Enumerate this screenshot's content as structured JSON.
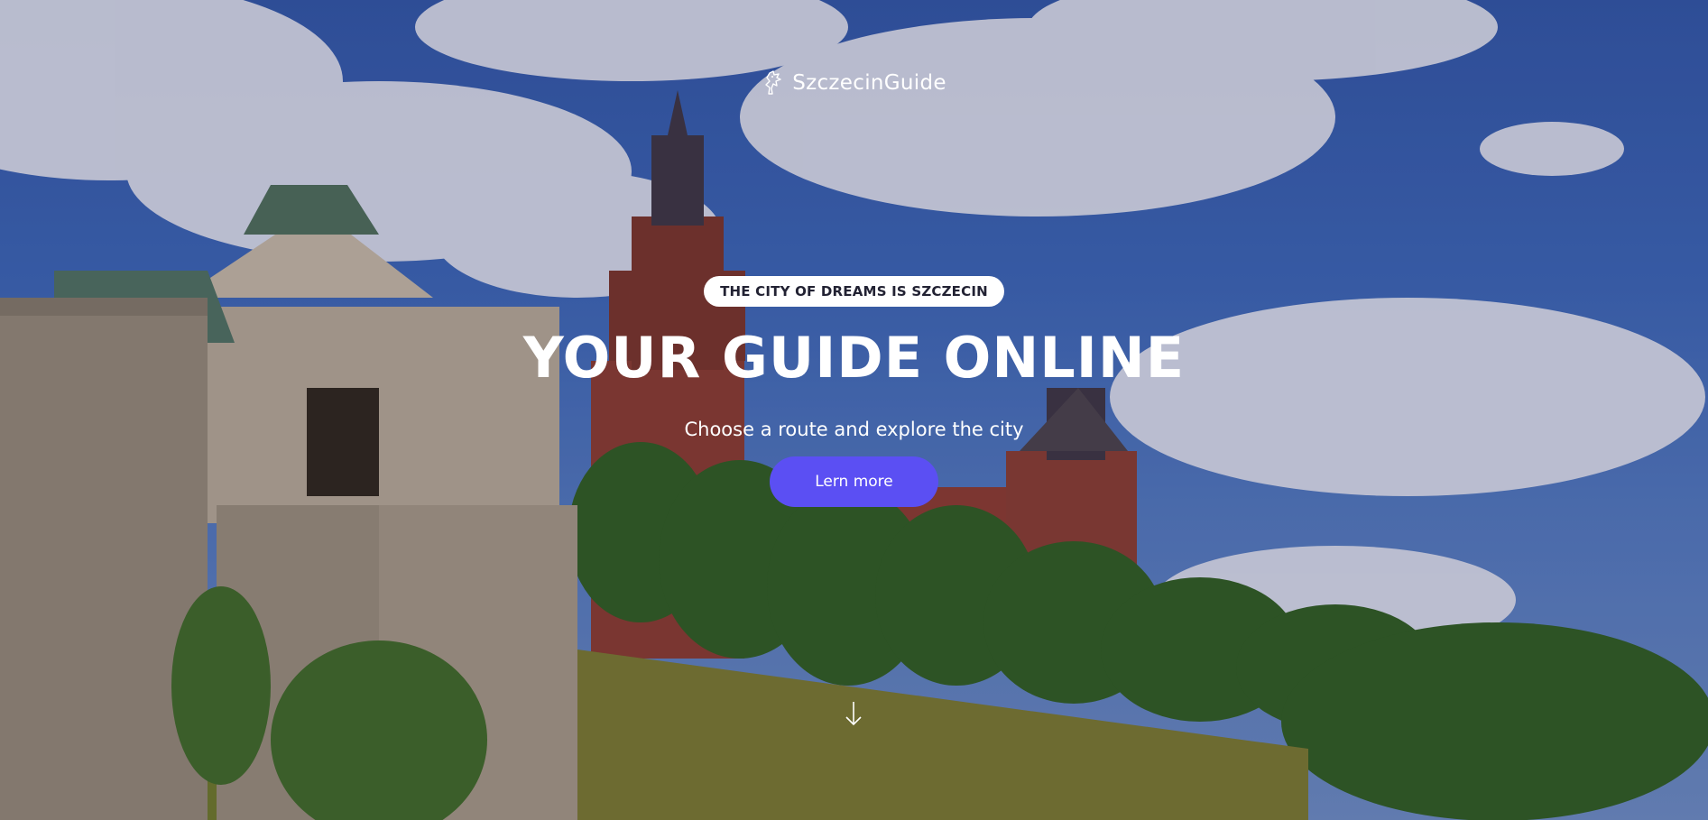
{
  "brand": {
    "name": "SzczecinGuide",
    "icon": "griffin-logo-icon"
  },
  "hero": {
    "badge": "THE CITY OF DREAMS IS SZCZECIN",
    "headline": "YOUR GUIDE ONLINE",
    "subheadline": "Choose a route and explore the city",
    "cta_label": "Lern more",
    "scroll_icon": "arrow-down-icon"
  },
  "colors": {
    "accent": "#5b4ff3",
    "badge_bg": "#ffffff",
    "text": "#ffffff",
    "badge_text": "#222233"
  }
}
